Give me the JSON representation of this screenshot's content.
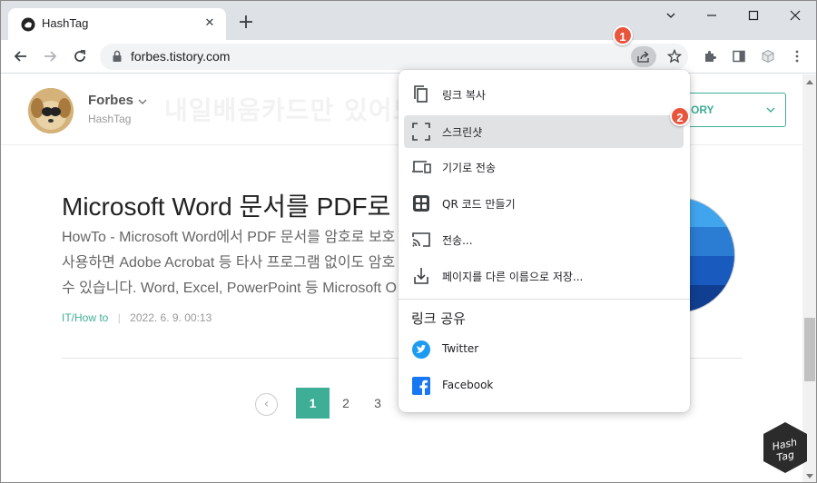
{
  "tab": {
    "title": "HashTag",
    "close": "✕",
    "new_tab": "+"
  },
  "window_controls": {
    "minimize": "—",
    "maximize": "☐",
    "close": "✕",
    "dropdown": "⌄"
  },
  "toolbar": {
    "url": "forbes.tistory.com"
  },
  "badges": {
    "first": "1",
    "second": "2"
  },
  "blog": {
    "name": "Forbes",
    "subtitle": "HashTag",
    "banner_text": "내일배움카드만 있어도",
    "category_label": "CATEGORY",
    "category_visible": "ORY"
  },
  "post": {
    "title": "Microsoft Word 문서를 PDF로",
    "excerpt": [
      "HowTo - Microsoft Word에서 PDF 문서를 암호로 보호",
      "사용하면 Adobe Acrobat 등 타사 프로그램 없이도 암호",
      "수 있습니다. Word, Excel, PowerPoint 등 Microsoft O"
    ],
    "category": "IT/How to",
    "separator": "|",
    "date": "2022. 6. 9. 00:13"
  },
  "pagination": {
    "prev": "‹",
    "current": "1",
    "pages": [
      "2",
      "3"
    ]
  },
  "share_menu": {
    "items": [
      {
        "label": "링크 복사",
        "icon": "copy-icon"
      },
      {
        "label": "스크린샷",
        "icon": "screenshot-icon",
        "highlighted": true
      },
      {
        "label": "기기로 전송",
        "icon": "devices-icon"
      },
      {
        "label": "QR 코드 만들기",
        "icon": "qr-code-icon"
      },
      {
        "label": "전송...",
        "icon": "cast-icon"
      },
      {
        "label": "페이지를 다른 이름으로 저장...",
        "icon": "save-page-icon"
      }
    ],
    "section_title": "링크 공유",
    "social": [
      {
        "label": "Twitter",
        "icon": "twitter-icon",
        "color": "#1d9bf0"
      },
      {
        "label": "Facebook",
        "icon": "facebook-icon",
        "color": "#1877f2"
      }
    ]
  },
  "colors": {
    "accent": "#3eae97",
    "badge": "#e9543d",
    "tabstrip": "#dee1e6"
  }
}
